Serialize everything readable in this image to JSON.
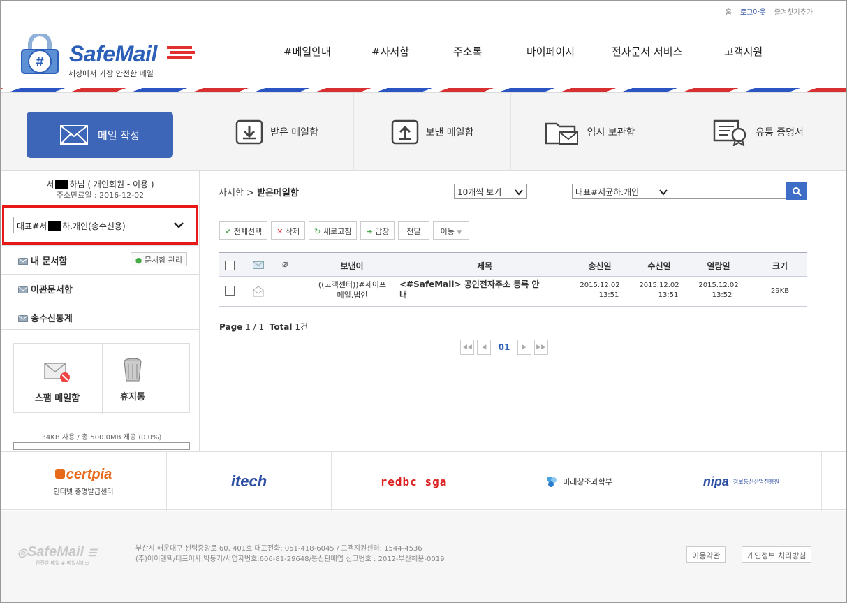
{
  "top_links": {
    "home": "홈",
    "logout": "로그아웃",
    "bookmark": "즐겨찾기추가"
  },
  "logo": {
    "brand_main": "SafeMail",
    "tagline": "세상에서 가장 안전한 메일",
    "seal_text": "SAFE MAIL"
  },
  "nav": [
    "#메일안내",
    "#사서함",
    "주소록",
    "마이페이지",
    "전자문서 서비스",
    "고객지원"
  ],
  "quick": {
    "compose": "메일 작성",
    "inbox": "받은 메일함",
    "sent": "보낸 메일함",
    "drafts": "임시 보관함",
    "cert": "유통 증명서"
  },
  "sidebar": {
    "user_prefix": "서",
    "user_suffix": "님 ( 개인회원 - 이용 )",
    "user_mid": "하",
    "expiry": "주소만료일 : 2016-12-02",
    "account_select": {
      "left": "대표#서",
      "right": "하.개인(송수신용)"
    },
    "my_box": "내 문서함",
    "box_manage": "문서함 관리",
    "transfer_box": "이관문서함",
    "stats": "송수신통계",
    "spam": "스팸 메일함",
    "trash": "휴지통",
    "usage_text": "34KB 사용 / 총 500.0MB 제공 (0.0%)",
    "usage_percent": 0.0
  },
  "main": {
    "breadcrumb_parent": "사서함 >",
    "breadcrumb_current": "받은메일함",
    "view_select": "10개씩 보기",
    "account_filter": "대표#서균하.개인",
    "search_value": "",
    "toolbar": {
      "select_all": "전체선택",
      "delete": "삭제",
      "refresh": "새로고침",
      "reply": "답장",
      "forward": "전달",
      "move": "이동"
    },
    "columns": {
      "sender": "보낸이",
      "subject": "제목",
      "sent": "송신일",
      "received": "수신일",
      "read": "열람일",
      "size": "크기"
    },
    "rows": [
      {
        "sender_line1": "((고객센터))#세이프",
        "sender_line2": "메일.법인",
        "subject_line1": "<#SafeMail> 공인전자주소 등록 안",
        "subject_line2": "내",
        "sent_date": "2015.12.02",
        "sent_time": "13:51",
        "recv_date": "2015.12.02",
        "recv_time": "13:51",
        "read_date": "2015.12.02",
        "read_time": "13:52",
        "size": "29KB"
      }
    ],
    "page_label": "Page",
    "page_value": "1 / 1",
    "total_label": "Total",
    "total_value": "1건",
    "current_page": "01",
    "pager": {
      "first": "◀◀",
      "prev": "◀",
      "next": "▶",
      "last": "▶▶"
    }
  },
  "partners": {
    "certpia": "certpia",
    "certpia_sub": "인터넷 증명발급센터",
    "itech": "itech",
    "redbc": "redbc sga",
    "msip": "미래창조과학부",
    "nipa": "nipa",
    "nipa_sub": "정보통신산업진흥원"
  },
  "footer": {
    "brand": "SafeMail",
    "brand_sub": "안전한 메일 # 메일서비스",
    "address_line1": "부산시 해운대구 센텀중앙로 60, 401호 대표전화: 051-418-6045 / 고객지원센터: 1544-4536",
    "address_line2": "(주)아이앤텍/대표이사:박동기/사업자번호:606-81-29648/통신판매업 신고번호 : 2012-부산해운-0019",
    "terms": "이용약관",
    "privacy": "개인정보 처리방침"
  },
  "colors": {
    "brand_blue": "#3d65b8",
    "brand_red": "#e23030",
    "highlight": "#e81818"
  }
}
